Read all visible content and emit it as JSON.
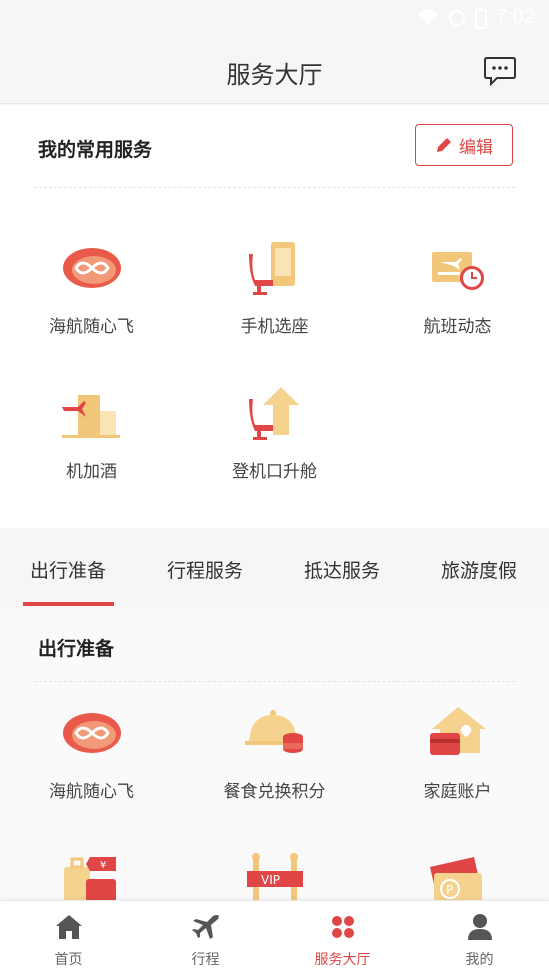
{
  "status_bar": {
    "time": "7:02"
  },
  "header": {
    "title": "服务大厅",
    "message_icon": "chat-bubble-icon"
  },
  "common_services": {
    "title": "我的常用服务",
    "edit_label": "编辑",
    "items": [
      {
        "label": "海航随心飞",
        "icon": "infinity-badge-icon"
      },
      {
        "label": "手机选座",
        "icon": "phone-seat-icon"
      },
      {
        "label": "航班动态",
        "icon": "flight-status-icon"
      },
      {
        "label": "机加酒",
        "icon": "flight-hotel-icon"
      },
      {
        "label": "登机口升舱",
        "icon": "seat-upgrade-icon"
      }
    ]
  },
  "tabs": [
    {
      "label": "出行准备",
      "active": true
    },
    {
      "label": "行程服务",
      "active": false
    },
    {
      "label": "抵达服务",
      "active": false
    },
    {
      "label": "旅游度假",
      "active": false
    }
  ],
  "travel_prep": {
    "title": "出行准备",
    "items": [
      {
        "label": "海航随心飞",
        "icon": "infinity-badge-icon"
      },
      {
        "label": "餐食兑换积分",
        "icon": "meal-points-icon"
      },
      {
        "label": "家庭账户",
        "icon": "family-account-icon"
      },
      {
        "label": "",
        "icon": "luggage-price-icon"
      },
      {
        "label": "",
        "icon": "vip-icon"
      },
      {
        "label": "",
        "icon": "parking-ticket-icon"
      }
    ]
  },
  "bottom_nav": [
    {
      "label": "首页",
      "icon": "home-icon",
      "active": false
    },
    {
      "label": "行程",
      "icon": "plane-icon",
      "active": false
    },
    {
      "label": "服务大厅",
      "icon": "grid-dots-icon",
      "active": true
    },
    {
      "label": "我的",
      "icon": "user-icon",
      "active": false
    }
  ],
  "colors": {
    "accent": "#e04646",
    "gold": "#f0c46a"
  }
}
